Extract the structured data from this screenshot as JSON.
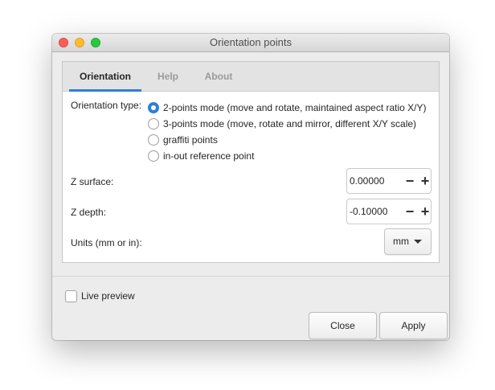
{
  "window": {
    "title": "Orientation points"
  },
  "tabs": [
    {
      "label": "Orientation",
      "active": true
    },
    {
      "label": "Help",
      "active": false
    },
    {
      "label": "About",
      "active": false
    }
  ],
  "orientation": {
    "label": "Orientation type:",
    "options": [
      {
        "label": "2-points mode (move and rotate, maintained aspect ratio X/Y)",
        "checked": true
      },
      {
        "label": "3-points mode (move, rotate and mirror, different X/Y scale)",
        "checked": false
      },
      {
        "label": "graffiti points",
        "checked": false
      },
      {
        "label": "in-out reference point",
        "checked": false
      }
    ]
  },
  "z_surface": {
    "label": "Z surface:",
    "value": "0.00000",
    "minus": "−",
    "plus": "+"
  },
  "z_depth": {
    "label": "Z depth:",
    "value": "-0.10000",
    "minus": "−",
    "plus": "+"
  },
  "units": {
    "label": "Units (mm or in):",
    "selected": "mm"
  },
  "live_preview": {
    "label": "Live preview",
    "checked": false
  },
  "buttons": {
    "close": "Close",
    "apply": "Apply"
  },
  "colors": {
    "accent": "#2f7ed8",
    "traffic_close": "#fe5f57",
    "traffic_minimize": "#febc2e",
    "traffic_maximize": "#28c840"
  }
}
